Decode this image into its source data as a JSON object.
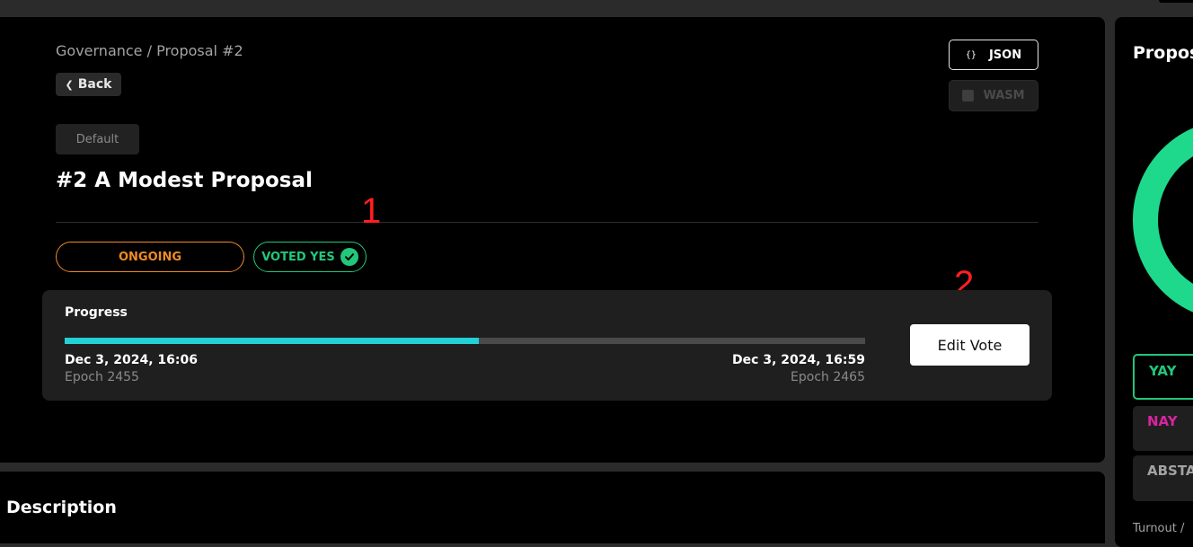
{
  "breadcrumb": "Governance / Proposal #2",
  "back_label": "Back",
  "tag": "Default",
  "title": "#2 A Modest Proposal",
  "buttons": {
    "json": "JSON",
    "wasm": "WASM"
  },
  "status": {
    "ongoing": "ONGOING",
    "voted": "VOTED YES"
  },
  "annotations": {
    "first": "1",
    "second": "2"
  },
  "progress": {
    "label": "Progress",
    "fraction": 0.517,
    "start_date": "Dec 3, 2024, 16:06",
    "start_epoch": "Epoch 2455",
    "end_date": "Dec 3, 2024, 16:59",
    "end_epoch": "Epoch 2465"
  },
  "edit_vote_label": "Edit Vote",
  "description_heading": "Description",
  "side": {
    "title": "Propos",
    "options": {
      "yay": "YAY",
      "nay": "NAY",
      "abstain": "ABSTA"
    },
    "turnout": "Turnout /"
  },
  "colors": {
    "ongoing": "#f08a24",
    "voted": "#22c77a",
    "progress_fill": "#22d1d6",
    "yay": "#22c77a",
    "nay": "#d6249f",
    "abstain": "#a3a3a3",
    "annotation": "#ff1f1f"
  },
  "icons": {
    "back": "chevron-left-icon",
    "json": "braces-icon",
    "wasm": "wasm-icon",
    "voted": "check-circle-icon"
  }
}
